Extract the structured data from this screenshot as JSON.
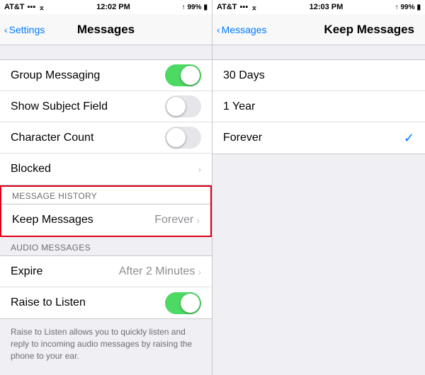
{
  "left": {
    "statusBar": {
      "carrier": "AT&T",
      "signal": "●●●○○",
      "time": "12:02 PM",
      "battery": "99%"
    },
    "navBar": {
      "backLabel": "Settings",
      "title": "Messages"
    },
    "rows": [
      {
        "id": "group-messaging",
        "label": "Group Messaging",
        "control": "toggle-on",
        "value": ""
      },
      {
        "id": "show-subject",
        "label": "Show Subject Field",
        "control": "toggle-off",
        "value": ""
      },
      {
        "id": "character-count",
        "label": "Character Count",
        "control": "toggle-off",
        "value": ""
      },
      {
        "id": "blocked",
        "label": "Blocked",
        "control": "chevron",
        "value": ""
      }
    ],
    "messageHistory": {
      "sectionHeader": "MESSAGE HISTORY",
      "keepLabel": "Keep Messages",
      "keepValue": "Forever"
    },
    "audioMessages": {
      "sectionHeader": "AUDIO MESSAGES",
      "expireLabel": "Expire",
      "expireValue": "After 2 Minutes",
      "raiseLabel": "Raise to Listen",
      "raiseControl": "toggle-on"
    },
    "bottomNote": "Raise to Listen allows you to quickly listen and reply to incoming audio messages by raising the phone to your ear."
  },
  "right": {
    "statusBar": {
      "carrier": "AT&T",
      "signal": "●●●○○",
      "time": "12:03 PM",
      "battery": "99%"
    },
    "navBar": {
      "backLabel": "Messages",
      "title": "Keep Messages"
    },
    "options": [
      {
        "id": "30-days",
        "label": "30 Days",
        "selected": false
      },
      {
        "id": "1-year",
        "label": "1 Year",
        "selected": false
      },
      {
        "id": "forever",
        "label": "Forever",
        "selected": true
      }
    ]
  },
  "icons": {
    "chevronLeft": "‹",
    "chevronRight": "›",
    "checkmark": "✓"
  }
}
